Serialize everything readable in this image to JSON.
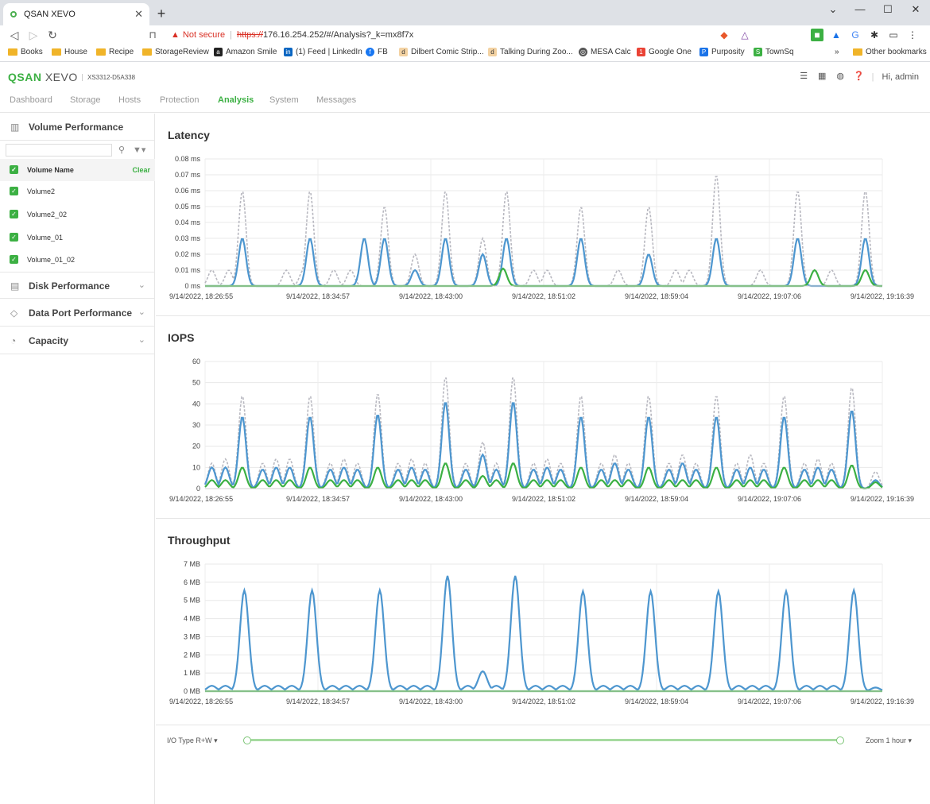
{
  "browser": {
    "tab_title": "QSAN XEVO",
    "url_warning": "Not secure",
    "url_scheme": "https://",
    "url_rest": "176.16.254.252/#/Analysis?_k=mx8f7x",
    "bookmarks": [
      "Books",
      "House",
      "Recipe",
      "StorageReview",
      "Amazon Smile",
      "(1) Feed | LinkedIn",
      "FB",
      "Dilbert Comic Strip...",
      "Talking During Zoo...",
      "MESA Calc",
      "Google One",
      "Purposity",
      "TownSq"
    ],
    "other_bookmarks": "Other bookmarks",
    "more": "»"
  },
  "app": {
    "logo_a": "QSAN",
    "logo_b": "XEVO",
    "serial": "XS3312-D5A338",
    "user": "Hi, admin",
    "menu": [
      "Dashboard",
      "Storage",
      "Hosts",
      "Protection",
      "Analysis",
      "System",
      "Messages"
    ],
    "active_menu": "Analysis"
  },
  "sidebar": {
    "sections": [
      "Volume Performance",
      "Disk Performance",
      "Data Port Performance",
      "Capacity"
    ],
    "column_header": "Volume Name",
    "clear": "Clear",
    "volumes": [
      "Volume2",
      "Volume2_02",
      "Volume_01",
      "Volume_01_02"
    ]
  },
  "colors": {
    "accent": "#3cb043",
    "blue": "#4d96cf",
    "green": "#3cb043",
    "gray": "#b8b8c0"
  },
  "x_ticks": [
    "9/14/2022, 18:26:55",
    "9/14/2022, 18:34:57",
    "9/14/2022, 18:43:00",
    "9/14/2022, 18:51:02",
    "9/14/2022, 18:59:04",
    "9/14/2022, 19:07:06",
    "9/14/2022, 19:16:39"
  ],
  "chart_data": [
    {
      "type": "line",
      "title": "Latency",
      "y_ticks": [
        "0 ms",
        "0.01 ms",
        "0.02 ms",
        "0.03 ms",
        "0.04 ms",
        "0.05 ms",
        "0.06 ms",
        "0.07 ms",
        "0.08 ms"
      ],
      "ylim": [
        0,
        0.08
      ],
      "series": [
        {
          "color": "gray",
          "dash": true,
          "peaks": [
            [
              0.01,
              0.01
            ],
            [
              0.035,
              0.01
            ],
            [
              0.055,
              0.06
            ],
            [
              0.12,
              0.01
            ],
            [
              0.145,
              0.01
            ],
            [
              0.155,
              0.06
            ],
            [
              0.19,
              0.01
            ],
            [
              0.215,
              0.01
            ],
            [
              0.265,
              0.05
            ],
            [
              0.31,
              0.02
            ],
            [
              0.355,
              0.06
            ],
            [
              0.41,
              0.03
            ],
            [
              0.445,
              0.06
            ],
            [
              0.485,
              0.01
            ],
            [
              0.505,
              0.01
            ],
            [
              0.555,
              0.05
            ],
            [
              0.61,
              0.01
            ],
            [
              0.655,
              0.05
            ],
            [
              0.695,
              0.01
            ],
            [
              0.715,
              0.01
            ],
            [
              0.755,
              0.07
            ],
            [
              0.82,
              0.01
            ],
            [
              0.875,
              0.06
            ],
            [
              0.925,
              0.01
            ],
            [
              0.975,
              0.06
            ]
          ]
        },
        {
          "color": "blue",
          "dash": false,
          "peaks": [
            [
              0.055,
              0.03
            ],
            [
              0.155,
              0.03
            ],
            [
              0.235,
              0.03
            ],
            [
              0.265,
              0.03
            ],
            [
              0.31,
              0.01
            ],
            [
              0.355,
              0.03
            ],
            [
              0.41,
              0.02
            ],
            [
              0.445,
              0.03
            ],
            [
              0.555,
              0.03
            ],
            [
              0.655,
              0.02
            ],
            [
              0.755,
              0.03
            ],
            [
              0.875,
              0.03
            ],
            [
              0.975,
              0.03
            ]
          ]
        },
        {
          "color": "green",
          "dash": false,
          "peaks": [
            [
              0.44,
              0.011
            ],
            [
              0.9,
              0.01
            ],
            [
              0.975,
              0.01
            ]
          ]
        }
      ]
    },
    {
      "type": "line",
      "title": "IOPS",
      "y_ticks": [
        "0",
        "10",
        "20",
        "30",
        "40",
        "50",
        "60"
      ],
      "ylim": [
        0,
        60
      ],
      "series": [
        {
          "color": "gray",
          "dash": true,
          "peaks": [
            [
              0.01,
              12
            ],
            [
              0.03,
              14
            ],
            [
              0.055,
              44
            ],
            [
              0.085,
              12
            ],
            [
              0.105,
              14
            ],
            [
              0.125,
              14
            ],
            [
              0.155,
              44
            ],
            [
              0.185,
              12
            ],
            [
              0.205,
              14
            ],
            [
              0.225,
              12
            ],
            [
              0.255,
              45
            ],
            [
              0.285,
              12
            ],
            [
              0.305,
              14
            ],
            [
              0.325,
              12
            ],
            [
              0.355,
              53
            ],
            [
              0.385,
              12
            ],
            [
              0.41,
              22
            ],
            [
              0.43,
              12
            ],
            [
              0.455,
              53
            ],
            [
              0.485,
              12
            ],
            [
              0.505,
              14
            ],
            [
              0.525,
              12
            ],
            [
              0.555,
              44
            ],
            [
              0.585,
              12
            ],
            [
              0.605,
              16
            ],
            [
              0.625,
              12
            ],
            [
              0.655,
              44
            ],
            [
              0.685,
              12
            ],
            [
              0.705,
              16
            ],
            [
              0.725,
              12
            ],
            [
              0.755,
              44
            ],
            [
              0.785,
              12
            ],
            [
              0.805,
              16
            ],
            [
              0.825,
              12
            ],
            [
              0.855,
              44
            ],
            [
              0.885,
              12
            ],
            [
              0.905,
              14
            ],
            [
              0.925,
              12
            ],
            [
              0.955,
              48
            ],
            [
              0.99,
              8
            ]
          ]
        },
        {
          "color": "blue",
          "dash": false,
          "peaks": [
            [
              0.01,
              10
            ],
            [
              0.03,
              10
            ],
            [
              0.055,
              34
            ],
            [
              0.085,
              9
            ],
            [
              0.105,
              10
            ],
            [
              0.125,
              10
            ],
            [
              0.155,
              34
            ],
            [
              0.185,
              9
            ],
            [
              0.205,
              10
            ],
            [
              0.225,
              9
            ],
            [
              0.255,
              35
            ],
            [
              0.285,
              9
            ],
            [
              0.305,
              10
            ],
            [
              0.325,
              9
            ],
            [
              0.355,
              41
            ],
            [
              0.385,
              9
            ],
            [
              0.41,
              16
            ],
            [
              0.43,
              9
            ],
            [
              0.455,
              41
            ],
            [
              0.485,
              9
            ],
            [
              0.505,
              10
            ],
            [
              0.525,
              9
            ],
            [
              0.555,
              34
            ],
            [
              0.585,
              9
            ],
            [
              0.605,
              12
            ],
            [
              0.625,
              9
            ],
            [
              0.655,
              34
            ],
            [
              0.685,
              9
            ],
            [
              0.705,
              12
            ],
            [
              0.725,
              9
            ],
            [
              0.755,
              34
            ],
            [
              0.785,
              9
            ],
            [
              0.805,
              10
            ],
            [
              0.825,
              9
            ],
            [
              0.855,
              34
            ],
            [
              0.885,
              9
            ],
            [
              0.905,
              10
            ],
            [
              0.925,
              9
            ],
            [
              0.955,
              37
            ],
            [
              0.99,
              4
            ]
          ]
        },
        {
          "color": "green",
          "dash": false,
          "peaks": [
            [
              0.01,
              4
            ],
            [
              0.03,
              4
            ],
            [
              0.055,
              10
            ],
            [
              0.085,
              4
            ],
            [
              0.105,
              4
            ],
            [
              0.125,
              4
            ],
            [
              0.155,
              10
            ],
            [
              0.185,
              4
            ],
            [
              0.205,
              4
            ],
            [
              0.225,
              4
            ],
            [
              0.255,
              10
            ],
            [
              0.285,
              4
            ],
            [
              0.305,
              4
            ],
            [
              0.325,
              4
            ],
            [
              0.355,
              12
            ],
            [
              0.385,
              4
            ],
            [
              0.41,
              6
            ],
            [
              0.43,
              4
            ],
            [
              0.455,
              12
            ],
            [
              0.485,
              4
            ],
            [
              0.505,
              4
            ],
            [
              0.525,
              4
            ],
            [
              0.555,
              10
            ],
            [
              0.585,
              4
            ],
            [
              0.605,
              4
            ],
            [
              0.625,
              4
            ],
            [
              0.655,
              10
            ],
            [
              0.685,
              4
            ],
            [
              0.705,
              4
            ],
            [
              0.725,
              4
            ],
            [
              0.755,
              10
            ],
            [
              0.785,
              4
            ],
            [
              0.805,
              4
            ],
            [
              0.825,
              4
            ],
            [
              0.855,
              10
            ],
            [
              0.885,
              4
            ],
            [
              0.905,
              4
            ],
            [
              0.925,
              4
            ],
            [
              0.955,
              11
            ],
            [
              0.99,
              3
            ]
          ]
        }
      ]
    },
    {
      "type": "line",
      "title": "Throughput",
      "y_ticks": [
        "0 MB",
        "1 MB",
        "2 MB",
        "3 MB",
        "4 MB",
        "5 MB",
        "6 MB",
        "7 MB"
      ],
      "ylim": [
        0,
        7
      ],
      "series": [
        {
          "color": "blue",
          "dash": false,
          "peaks": [
            [
              0.01,
              0.3
            ],
            [
              0.03,
              0.3
            ],
            [
              0.058,
              5.55
            ],
            [
              0.088,
              0.3
            ],
            [
              0.108,
              0.3
            ],
            [
              0.128,
              0.3
            ],
            [
              0.158,
              5.55
            ],
            [
              0.188,
              0.3
            ],
            [
              0.208,
              0.3
            ],
            [
              0.228,
              0.3
            ],
            [
              0.258,
              5.55
            ],
            [
              0.288,
              0.3
            ],
            [
              0.308,
              0.3
            ],
            [
              0.328,
              0.3
            ],
            [
              0.358,
              6.35
            ],
            [
              0.388,
              0.3
            ],
            [
              0.41,
              1.1
            ],
            [
              0.43,
              0.3
            ],
            [
              0.458,
              6.35
            ],
            [
              0.488,
              0.3
            ],
            [
              0.508,
              0.3
            ],
            [
              0.528,
              0.3
            ],
            [
              0.558,
              5.5
            ],
            [
              0.588,
              0.3
            ],
            [
              0.608,
              0.3
            ],
            [
              0.628,
              0.3
            ],
            [
              0.658,
              5.5
            ],
            [
              0.688,
              0.3
            ],
            [
              0.708,
              0.3
            ],
            [
              0.728,
              0.3
            ],
            [
              0.758,
              5.5
            ],
            [
              0.788,
              0.3
            ],
            [
              0.808,
              0.3
            ],
            [
              0.828,
              0.3
            ],
            [
              0.858,
              5.5
            ],
            [
              0.888,
              0.3
            ],
            [
              0.908,
              0.3
            ],
            [
              0.928,
              0.3
            ],
            [
              0.958,
              5.55
            ],
            [
              0.99,
              0.2
            ]
          ]
        },
        {
          "color": "green",
          "dash": false,
          "peaks": []
        }
      ]
    }
  ],
  "footer": {
    "io_type": "I/O Type R+W",
    "zoom": "Zoom 1 hour",
    "slider_start": 0,
    "slider_end": 1
  }
}
